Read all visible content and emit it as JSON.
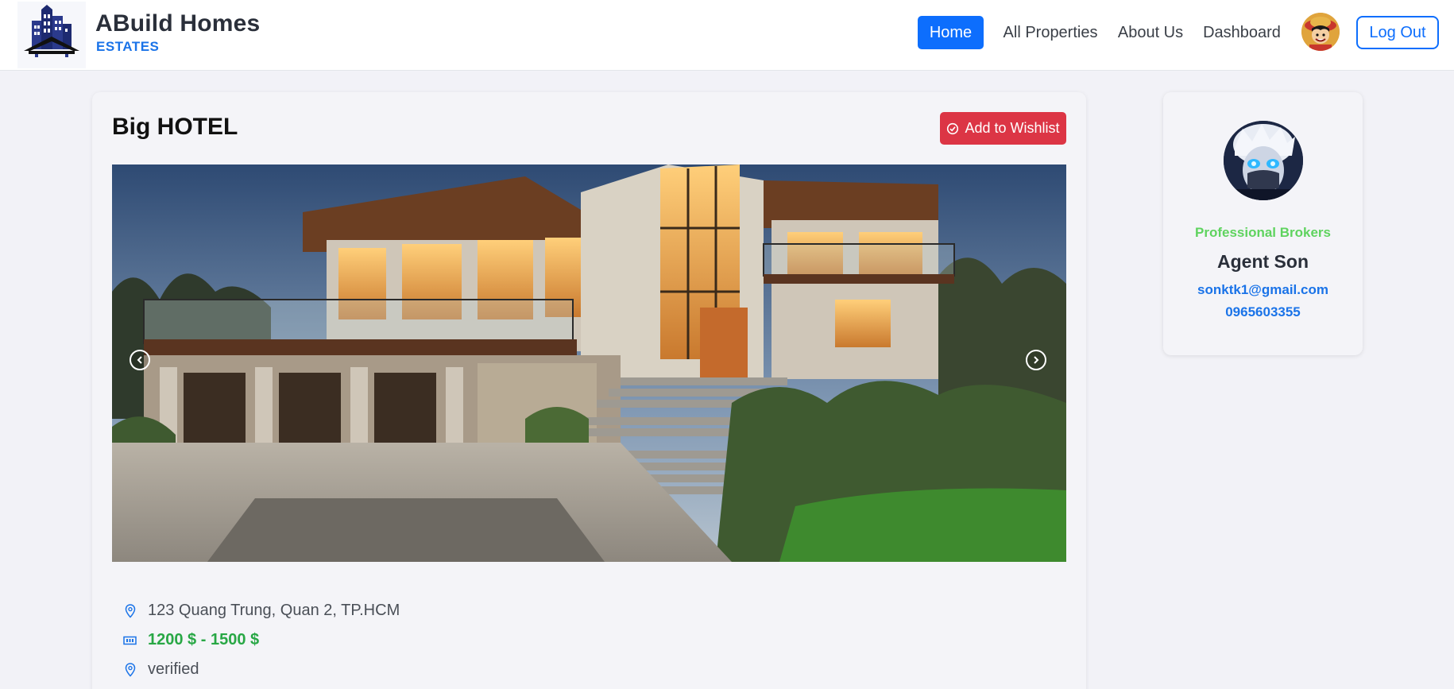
{
  "brand": {
    "title": "ABuild Homes",
    "subtitle": "ESTATES",
    "logo_icon": "city-buildings-logo-icon"
  },
  "nav": {
    "items": [
      {
        "label": "Home",
        "active": true
      },
      {
        "label": "All Properties",
        "active": false
      },
      {
        "label": "About Us",
        "active": false
      },
      {
        "label": "Dashboard",
        "active": false
      }
    ],
    "avatar_icon": "user-avatar-icon",
    "logout_label": "Log Out"
  },
  "property": {
    "title": "Big HOTEL",
    "wishlist_label": "Add to Wishlist",
    "wishlist_icon": "check-badge-icon",
    "image_alt": "modern-house-photo",
    "carousel_prev_icon": "chevron-left-icon",
    "carousel_next_icon": "chevron-right-icon",
    "address": "123 Quang Trung, Quan 2, TP.HCM",
    "address_icon": "map-pin-icon",
    "price": "1200 $ - 1500 $",
    "price_icon": "money-bill-icon",
    "status": "verified",
    "status_icon": "map-pin-icon"
  },
  "agent": {
    "role": "Professional Brokers",
    "name": "Agent Son",
    "email": "sonktk1@gmail.com",
    "phone": "0965603355",
    "avatar_icon": "agent-avatar-icon"
  },
  "colors": {
    "primary": "#0d6efd",
    "danger": "#dc3545",
    "success": "#28a745",
    "role_green": "#5fd35f",
    "link_blue": "#1a73e8",
    "page_bg": "#f2f2f7"
  }
}
